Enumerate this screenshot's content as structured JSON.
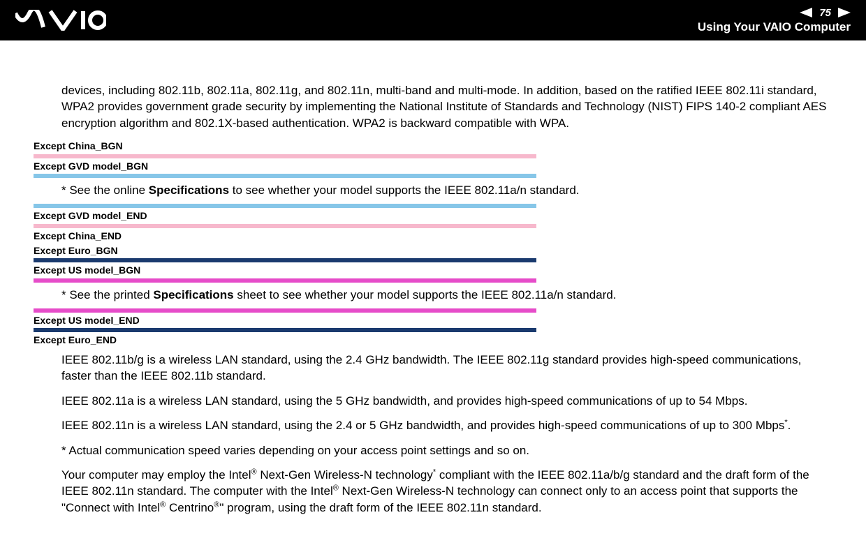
{
  "header": {
    "logo_text": "VAIO",
    "page_number": "75",
    "section_title": "Using Your VAIO Computer"
  },
  "body": {
    "intro": "devices, including 802.11b, 802.11a, 802.11g, and 802.11n, multi-band and multi-mode. In addition, based on the ratified IEEE 802.11i standard, WPA2 provides government grade security by implementing the National Institute of Standards and Technology (NIST) FIPS 140-2 compliant AES encryption algorithm and 802.1X-based authentication. WPA2 is backward compatible with WPA.",
    "markers": {
      "except_china_bgn": "Except China_BGN",
      "except_gvd_bgn": "Except GVD model_BGN",
      "except_gvd_end": "Except GVD model_END",
      "except_china_end": "Except China_END",
      "except_euro_bgn": "Except Euro_BGN",
      "except_us_bgn": "Except US model_BGN",
      "except_us_end": "Except US model_END",
      "except_euro_end": "Except Euro_END"
    },
    "note1_prefix": "*  See the online ",
    "note1_bold": "Specifications",
    "note1_suffix": " to see whether your model supports the IEEE 802.11a/n standard.",
    "note2_prefix": "*  See the printed ",
    "note2_bold": "Specifications",
    "note2_suffix": " sheet to see whether your model supports the IEEE 802.11a/n standard.",
    "p_bg": "IEEE 802.11b/g is a wireless LAN standard, using the 2.4 GHz bandwidth. The IEEE 802.11g standard provides high-speed communications, faster than the IEEE 802.11b standard.",
    "p_a": "IEEE 802.11a is a wireless LAN standard, using the 5 GHz bandwidth, and provides high-speed communications of up to 54 Mbps.",
    "p_n_pre": "IEEE 802.11n is a wireless LAN standard, using the 2.4 or 5 GHz bandwidth, and provides high-speed communications of up to 300 Mbps",
    "p_n_post": ".",
    "p_actual": "*  Actual communication speed varies depending on your access point settings and so on.",
    "p_intel_1": "Your computer may employ the Intel",
    "p_intel_2": " Next-Gen Wireless-N technology",
    "p_intel_3": " compliant with the IEEE 802.11a/b/g standard and the draft form of the IEEE 802.11n standard. The computer with the Intel",
    "p_intel_4": " Next-Gen Wireless-N technology can connect only to an access point that supports the \"Connect with Intel",
    "p_intel_5": " Centrino",
    "p_intel_6": "\" program, using the draft form of the IEEE 802.11n standard.",
    "reg": "®",
    "star": "*"
  }
}
